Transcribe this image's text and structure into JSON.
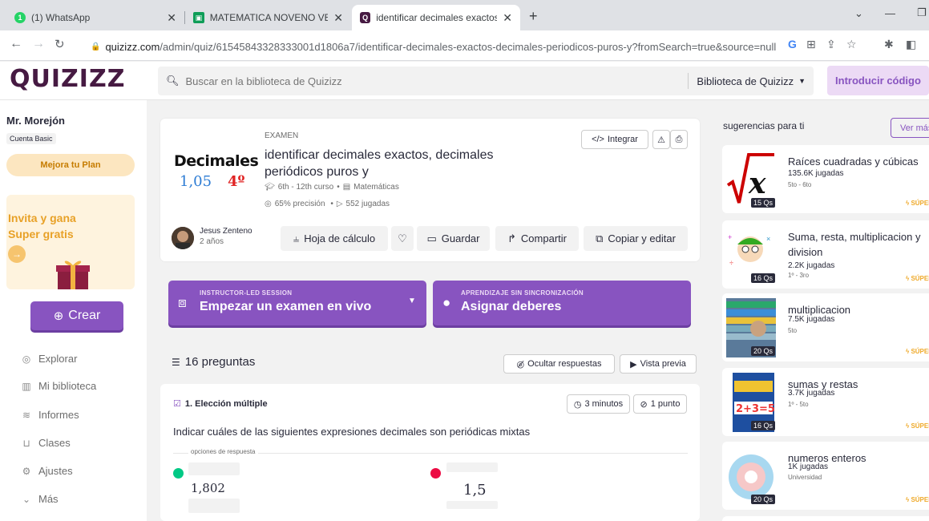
{
  "browser": {
    "tabs": [
      {
        "title": "(1) WhatsApp",
        "favicon": "whatsapp-icon",
        "badge": "1"
      },
      {
        "title": "MATEMATICA NOVENO VESPERTI",
        "favicon": "classroom-icon"
      },
      {
        "title": "identificar decimales exactos, dec",
        "favicon": "quizizz-icon",
        "active": true
      }
    ],
    "new_tab": "+",
    "url_domain": "quizizz.com",
    "url_path": "/admin/quiz/61545843328333001d1806a7/identificar-decimales-exactos-decimales-periodicos-puros-y?fromSearch=true&source=null",
    "window_controls": [
      "⌄",
      "—",
      "❐"
    ]
  },
  "app": {
    "logo": "QUIZIZZ",
    "search_placeholder": "Buscar en la biblioteca de Quizizz",
    "library_select": "Biblioteca de Quizizz",
    "enter_code": "Introducir código",
    "accent": "#8854c0",
    "brand": "#461a42"
  },
  "sidebar": {
    "user_name": "Mr. Morejón",
    "plan": "Cuenta Basic",
    "upgrade": "Mejora tu Plan",
    "invite_title": "Invita y gana Super gratis",
    "create": "Crear",
    "nav": [
      {
        "label": "Explorar",
        "icon": "compass-icon"
      },
      {
        "label": "Mi biblioteca",
        "icon": "library-icon"
      },
      {
        "label": "Informes",
        "icon": "reports-icon"
      },
      {
        "label": "Clases",
        "icon": "classes-icon"
      },
      {
        "label": "Ajustes",
        "icon": "settings-icon"
      },
      {
        "label": "Más",
        "icon": "chevron-down-icon"
      }
    ]
  },
  "quiz": {
    "type": "EXAMEN",
    "title": "identificar decimales exactos, decimales periódicos puros y",
    "thumb_word": "Decimales",
    "thumb_num1": "1,05",
    "thumb_num2": "4º",
    "grades": "6th - 12th curso",
    "subject": "Matemáticas",
    "accuracy": "65% precisión",
    "plays": "552 jugadas",
    "embed": "Integrar",
    "author": "Jesus Zenteno",
    "age": "2 años",
    "actions": {
      "spreadsheet": "Hoja de cálculo",
      "save": "Guardar",
      "share": "Compartir",
      "copy_edit": "Copiar y editar"
    }
  },
  "launch": {
    "live_small": "INSTRUCTOR-LED SESSION",
    "live_big": "Empezar un examen en vivo",
    "hw_small": "APRENDIZAJE SIN SINCRONIZACIÓN",
    "hw_big": "Asignar deberes"
  },
  "questions": {
    "count": "16 preguntas",
    "hide_answers": "Ocultar respuestas",
    "preview": "Vista previa",
    "q1": {
      "type": "1. Elección múltiple",
      "time": "3 minutos",
      "points": "1 punto",
      "text": "Indicar cuáles de las siguientes expresiones decimales son periódicas mixtas",
      "options_label": "opciones de respuesta",
      "opt_a": "1,802",
      "opt_b": "1,5",
      "colors": {
        "correct": "#00c985",
        "wrong": "#ec0b43"
      }
    }
  },
  "suggestions": {
    "title": "sugerencias para ti",
    "see_more": "Ver más",
    "super": "SÚPER",
    "items": [
      {
        "title": "Raíces cuadradas y cúbicas",
        "plays": "135.6K jugadas",
        "grade": "5to - 6to",
        "qs": "15 Qs"
      },
      {
        "title": "Suma, resta, multiplicacion y division",
        "plays": "2.2K jugadas",
        "grade": "1º - 3ro",
        "qs": "16 Qs"
      },
      {
        "title": "multiplicacion",
        "plays": "7.5K jugadas",
        "grade": "5to",
        "qs": "20 Qs"
      },
      {
        "title": "sumas y restas",
        "plays": "3.7K jugadas",
        "grade": "1º - 5to",
        "qs": "16 Qs"
      },
      {
        "title": "numeros enteros",
        "plays": "1K jugadas",
        "grade": "Universidad",
        "qs": "20 Qs"
      }
    ]
  }
}
